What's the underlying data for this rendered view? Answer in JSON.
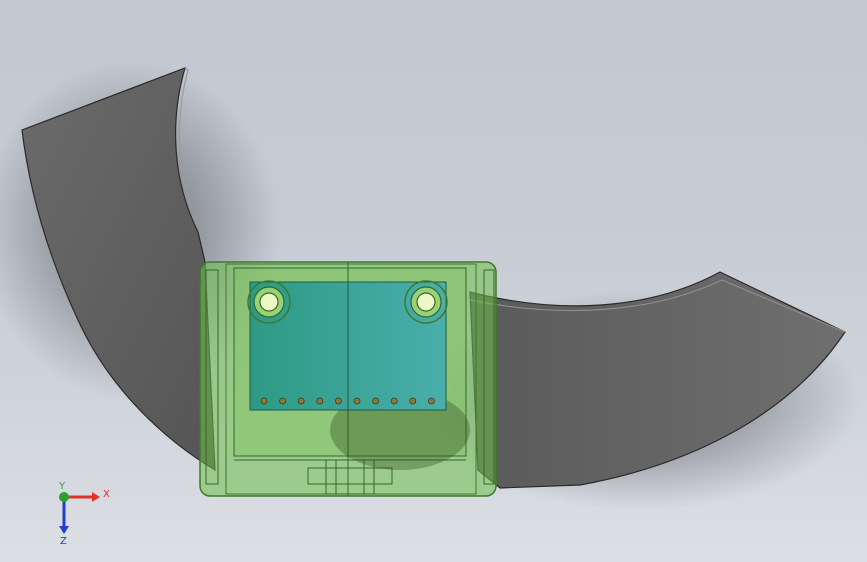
{
  "viewport": {
    "background_top": "#c3c8d0",
    "background_bottom": "#dcdfe4"
  },
  "model": {
    "fan_blade_color": "#5f5f5f",
    "housing_color": "#6fbf4a",
    "pcb_color": "#3aa68c",
    "pin_count": 10,
    "mount_hole_count": 2
  },
  "triad": {
    "x_label": "X",
    "y_label": "Y",
    "z_label": "Z",
    "x_color": "#e0332b",
    "y_color": "#2ca02c",
    "z_color": "#1f3fcf"
  }
}
